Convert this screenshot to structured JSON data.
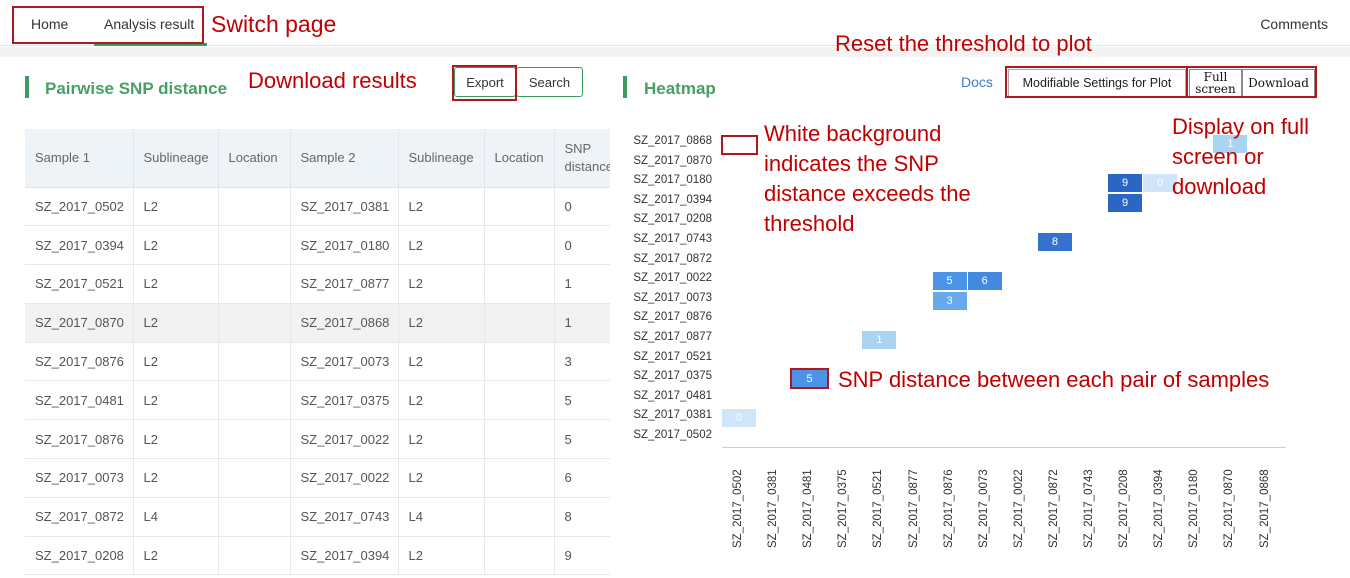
{
  "nav": {
    "home": "Home",
    "analysis": "Analysis result",
    "comments": "Comments"
  },
  "left": {
    "title": "Pairwise SNP distance",
    "export_label": "Export",
    "search_label": "Search",
    "columns": [
      "Sample 1",
      "Sublineage",
      "Location",
      "Sample 2",
      "Sublineage",
      "Location",
      "SNP distance"
    ],
    "rows": [
      [
        "SZ_2017_0502",
        "L2",
        "",
        "SZ_2017_0381",
        "L2",
        "",
        "0"
      ],
      [
        "SZ_2017_0394",
        "L2",
        "",
        "SZ_2017_0180",
        "L2",
        "",
        "0"
      ],
      [
        "SZ_2017_0521",
        "L2",
        "",
        "SZ_2017_0877",
        "L2",
        "",
        "1"
      ],
      [
        "SZ_2017_0870",
        "L2",
        "",
        "SZ_2017_0868",
        "L2",
        "",
        "1"
      ],
      [
        "SZ_2017_0876",
        "L2",
        "",
        "SZ_2017_0073",
        "L2",
        "",
        "3"
      ],
      [
        "SZ_2017_0481",
        "L2",
        "",
        "SZ_2017_0375",
        "L2",
        "",
        "5"
      ],
      [
        "SZ_2017_0876",
        "L2",
        "",
        "SZ_2017_0022",
        "L2",
        "",
        "5"
      ],
      [
        "SZ_2017_0073",
        "L2",
        "",
        "SZ_2017_0022",
        "L2",
        "",
        "6"
      ],
      [
        "SZ_2017_0872",
        "L4",
        "",
        "SZ_2017_0743",
        "L4",
        "",
        "8"
      ],
      [
        "SZ_2017_0208",
        "L2",
        "",
        "SZ_2017_0394",
        "L2",
        "",
        "9"
      ]
    ]
  },
  "right": {
    "title": "Heatmap",
    "docs_label": "Docs",
    "settings_label": "Modifiable Settings for Plot",
    "fullscreen_label": "Full screen",
    "download_label": "Download"
  },
  "heatmap": {
    "y_labels": [
      "SZ_2017_0868",
      "SZ_2017_0870",
      "SZ_2017_0180",
      "SZ_2017_0394",
      "SZ_2017_0208",
      "SZ_2017_0743",
      "SZ_2017_0872",
      "SZ_2017_0022",
      "SZ_2017_0073",
      "SZ_2017_0876",
      "SZ_2017_0877",
      "SZ_2017_0521",
      "SZ_2017_0375",
      "SZ_2017_0481",
      "SZ_2017_0381",
      "SZ_2017_0502"
    ],
    "x_labels": [
      "SZ_2017_0502",
      "SZ_2017_0381",
      "SZ_2017_0481",
      "SZ_2017_0375",
      "SZ_2017_0521",
      "SZ_2017_0877",
      "SZ_2017_0876",
      "SZ_2017_0073",
      "SZ_2017_0022",
      "SZ_2017_0872",
      "SZ_2017_0743",
      "SZ_2017_0208",
      "SZ_2017_0394",
      "SZ_2017_0180",
      "SZ_2017_0870",
      "SZ_2017_0868"
    ],
    "cells": [
      {
        "row": 0,
        "col": 14,
        "value": "1",
        "color": "#a9d4f2"
      },
      {
        "row": 2,
        "col": 11,
        "value": "9",
        "color": "#2a67c4"
      },
      {
        "row": 2,
        "col": 12,
        "value": "0",
        "color": "#cfe6fa"
      },
      {
        "row": 3,
        "col": 11,
        "value": "9",
        "color": "#2a67c4"
      },
      {
        "row": 5,
        "col": 9,
        "value": "8",
        "color": "#3572cf"
      },
      {
        "row": 7,
        "col": 6,
        "value": "5",
        "color": "#4a93e6"
      },
      {
        "row": 7,
        "col": 7,
        "value": "6",
        "color": "#4289e0"
      },
      {
        "row": 8,
        "col": 6,
        "value": "3",
        "color": "#68a9ec"
      },
      {
        "row": 10,
        "col": 4,
        "value": "1",
        "color": "#a9d4f2"
      },
      {
        "row": 14,
        "col": 0,
        "value": "0",
        "color": "#cfe6fa"
      }
    ],
    "legend_sample_value": "5",
    "legend_sample_color": "#4a93e6"
  },
  "annotations": {
    "switch_page": "Switch page",
    "download_results": "Download results",
    "reset_threshold": "Reset the threshold to plot",
    "white_bg": "White background indicates the SNP distance exceeds the threshold",
    "white_bg_lines": [
      "White background",
      "indicates the SNP",
      "distance exceeds the",
      "threshold"
    ],
    "full_screen": "Display on full screen or download",
    "full_screen_lines": [
      "Display on full",
      "screen or",
      "download"
    ],
    "snp_pair": "SNP distance between each pair of samples"
  }
}
